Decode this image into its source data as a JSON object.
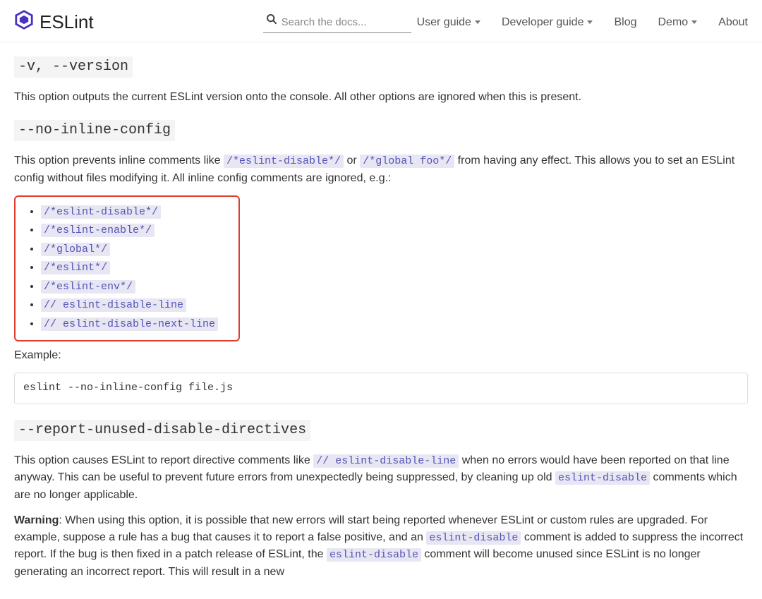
{
  "nav": {
    "brand": "ESLint",
    "search_placeholder": "Search the docs...",
    "links": {
      "user_guide": "User guide",
      "developer_guide": "Developer guide",
      "blog": "Blog",
      "demo": "Demo",
      "about": "About"
    }
  },
  "sections": {
    "version": {
      "heading": "-v, --version",
      "desc": "This option outputs the current ESLint version onto the console. All other options are ignored when this is present."
    },
    "no_inline": {
      "heading": "--no-inline-config",
      "desc_a": "This option prevents inline comments like ",
      "code_a": "/*eslint-disable*/",
      "desc_b": " or ",
      "code_b": "/*global foo*/",
      "desc_c": " from having any effect. This allows you to set an ESLint config without files modifying it. All inline config comments are ignored, e.g.:",
      "items": [
        "/*eslint-disable*/",
        "/*eslint-enable*/",
        "/*global*/",
        "/*eslint*/",
        "/*eslint-env*/",
        "// eslint-disable-line",
        "// eslint-disable-next-line"
      ],
      "example_label": "Example:",
      "example_code": "eslint --no-inline-config file.js"
    },
    "report": {
      "heading": "--report-unused-disable-directives",
      "p1_a": "This option causes ESLint to report directive comments like ",
      "p1_code": "// eslint-disable-line",
      "p1_b": " when no errors would have been reported on that line anyway. This can be useful to prevent future errors from unexpectedly being suppressed, by cleaning up old ",
      "p1_code2": "eslint-disable",
      "p1_c": " comments which are no longer applicable.",
      "p2_label": "Warning",
      "p2_a": ": When using this option, it is possible that new errors will start being reported whenever ESLint or custom rules are upgraded. For example, suppose a rule has a bug that causes it to report a false positive, and an ",
      "p2_code1": "eslint-disable",
      "p2_b": " comment is added to suppress the incorrect report. If the bug is then fixed in a patch release of ESLint, the ",
      "p2_code2": "eslint-disable",
      "p2_c": " comment will become unused since ESLint is no longer generating an incorrect report. This will result in a new"
    }
  }
}
